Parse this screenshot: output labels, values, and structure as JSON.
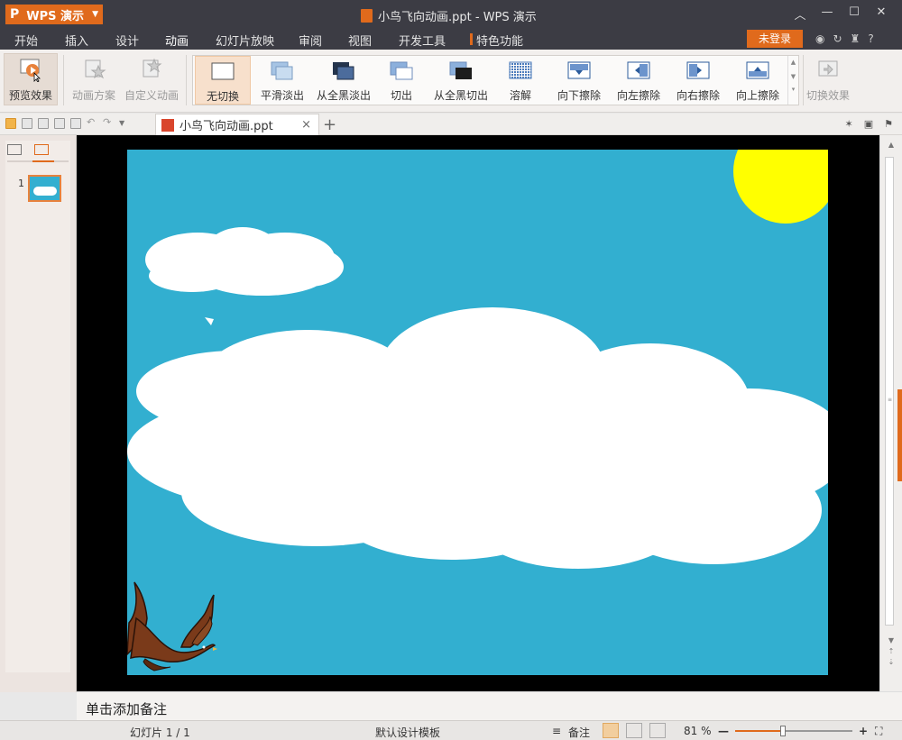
{
  "app": {
    "logo": "P",
    "name": "WPS 演示",
    "doc_title": "小鸟飞向动画.ppt - WPS 演示",
    "window_controls": [
      "chevron-up-icon",
      "minimize-icon",
      "maximize-icon",
      "close-icon"
    ]
  },
  "menu": {
    "tabs": [
      "开始",
      "插入",
      "设计",
      "动画",
      "幻灯片放映",
      "审阅",
      "视图",
      "开发工具",
      "特色功能"
    ],
    "active": "动画",
    "login_label": "未登录",
    "help": "?"
  },
  "ribbon": {
    "preview_label": "预览效果",
    "animation_scheme_label": "动画方案",
    "custom_animation_label": "自定义动画",
    "transitions": [
      "无切换",
      "平滑淡出",
      "从全黑淡出",
      "切出",
      "从全黑切出",
      "溶解",
      "向下擦除",
      "向左擦除",
      "向右擦除",
      "向上擦除"
    ],
    "selected_transition": "无切换",
    "switch_effect_label": "切换效果"
  },
  "doctab": {
    "filename": "小鸟飞向动画.ppt",
    "close": "×",
    "new_tab": "+"
  },
  "slides_panel": {
    "slide_number": "1"
  },
  "notes": {
    "placeholder": "单击添加备注"
  },
  "status": {
    "slide_info": "幻灯片 1 / 1",
    "template": "默认设计模板",
    "notes_label": "备注",
    "zoom": "81 %",
    "zoom_level": 0.41
  },
  "colors": {
    "accent": "#e06a1c",
    "titlebar": "#3c3c44",
    "slide_bg": "#32afd0",
    "sun": "#ffff00"
  }
}
